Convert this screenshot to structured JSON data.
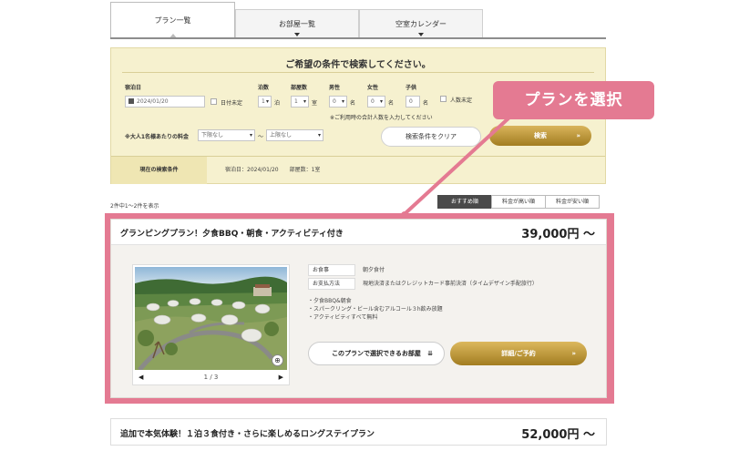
{
  "tabs": [
    {
      "label": "プラン一覧",
      "active": true
    },
    {
      "label": "お部屋一覧",
      "active": false
    },
    {
      "label": "空室カレンダー",
      "active": false
    }
  ],
  "search": {
    "title": "ご希望の条件で検索してください。",
    "date_label": "宿泊日",
    "date_value": "2024/01/20",
    "date_undecided": "日付未定",
    "nights_label": "泊数",
    "nights_value": "1",
    "nights_unit": "泊",
    "rooms_label": "部屋数",
    "rooms_value": "1",
    "rooms_unit": "室",
    "male_label": "男性",
    "male_value": "0",
    "female_label": "女性",
    "female_value": "0",
    "child_label": "子供",
    "child_value": "0",
    "person_unit": "名",
    "people_undecided": "人数未定",
    "note": "※ご利用時の合計人数を入力してください",
    "price_label": "※大人1名様あたりの料金",
    "price_min": "下限なし",
    "price_sep": "〜",
    "price_max": "上限なし",
    "clear_button": "検索条件をクリア",
    "search_button": "検索",
    "arrow": "»",
    "current_label": "現在の検索条件",
    "current_value": "宿泊日：2024/01/20　　部屋数：1室"
  },
  "results": {
    "count_text": "2件中1〜2件を表示",
    "sort_tabs": [
      {
        "label": "おすすめ順",
        "active": true
      },
      {
        "label": "料金が高い順",
        "active": false
      },
      {
        "label": "料金が安い順",
        "active": false
      }
    ]
  },
  "plans": [
    {
      "title": "グランピングプラン！夕食BBQ・朝食・アクティビティ付き",
      "price": "39,000円 〜",
      "meal_key": "お食事",
      "meal_value": "朝夕食付",
      "payment_key": "お支払方法",
      "payment_value": "現地決済またはクレジットカード事前決済（タイムデザイン手配旅行）",
      "features": [
        "夕食BBQ&朝食",
        "スパークリング・ビール含むアルコール３h飲み放題",
        "アクティビティすべて無料"
      ],
      "pager": "1 / 3",
      "pager_prev": "◀",
      "pager_next": "▶",
      "rooms_button": "このプランで選択できるお部屋",
      "rooms_arrow": "»",
      "detail_button": "詳細/ご予約",
      "detail_arrow": "»"
    },
    {
      "title": "追加で本気体験！１泊３食付き・さらに楽しめるロングステイプラン",
      "price": "52,000円 〜"
    }
  ],
  "annotation": {
    "label": "プランを選択",
    "color": "#e47a92"
  }
}
